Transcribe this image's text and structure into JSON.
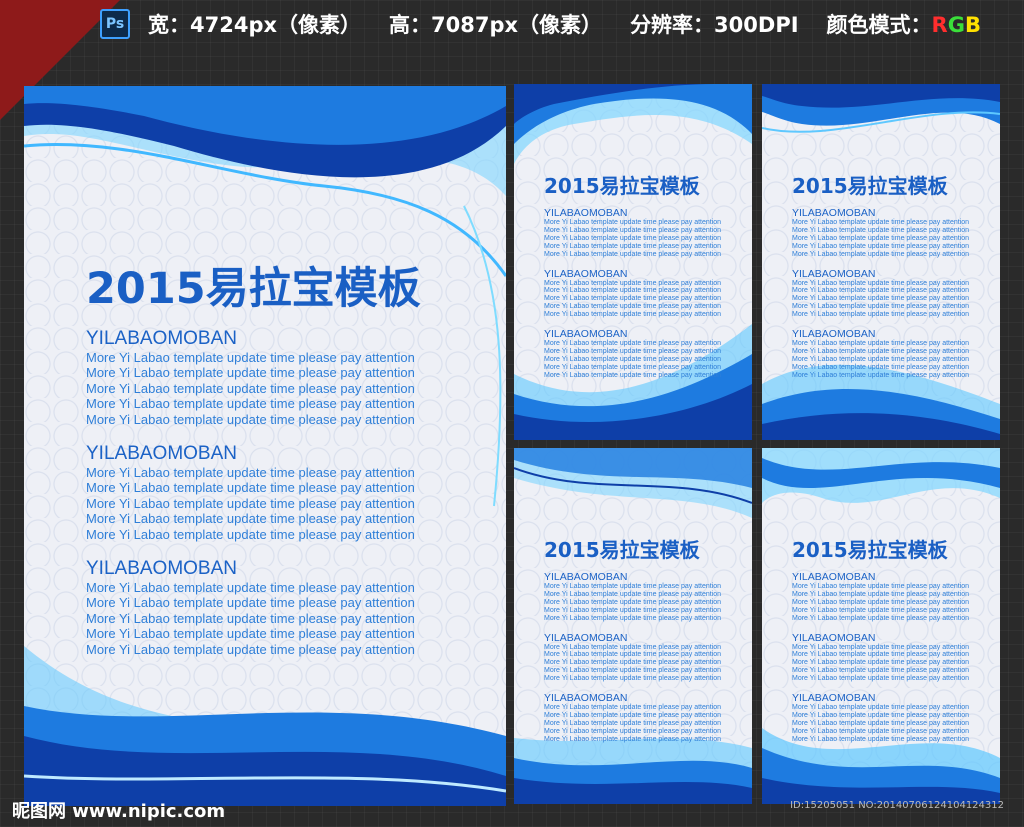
{
  "header": {
    "app_icon": "photoshop-icon",
    "app_label": "Ps",
    "width_text": "宽：4724px（像素）",
    "height_text": "高：7087px（像素）",
    "dpi_text": "分辨率：300DPI",
    "color_mode_label": "颜色模式：",
    "color_mode_r": "R",
    "color_mode_g": "G",
    "color_mode_b": "B"
  },
  "poster": {
    "title": "2015易拉宝模板",
    "section_title": "YILABAOMOBAN",
    "line": "More Yi Labao template update time please pay attention"
  },
  "footer": {
    "site": "昵图网 www.nipic.com",
    "id_text": "ID:15205051 NO:20140706124104124312"
  },
  "colors": {
    "background": "#2a2a2a",
    "accent": "#1a5fc4",
    "wave_dark": "#0e3fa8",
    "wave_light": "#5ec8ff"
  }
}
